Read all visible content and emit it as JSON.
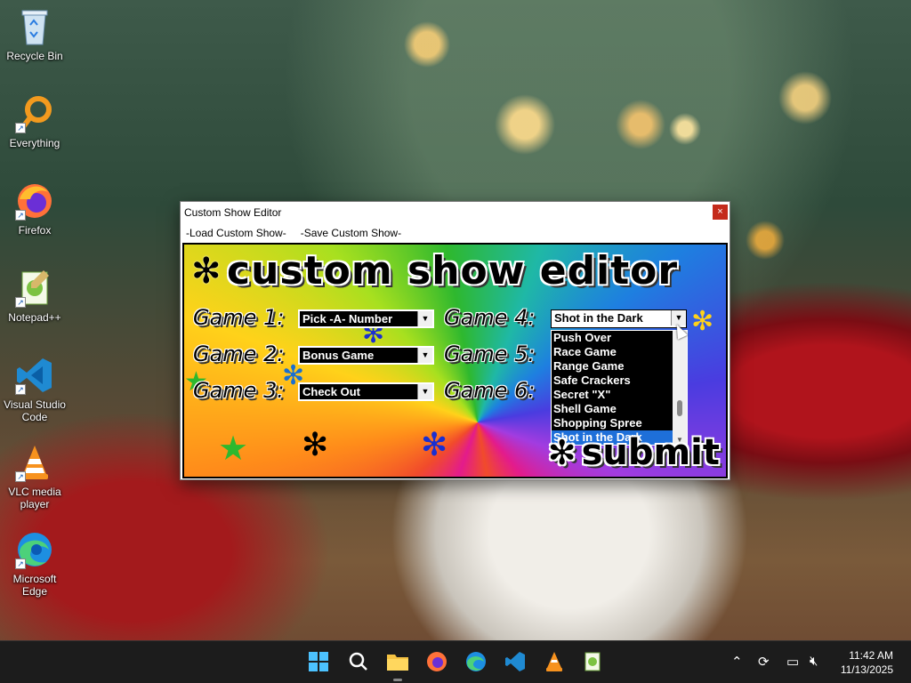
{
  "desktop": {
    "icons": [
      {
        "label": "Recycle Bin",
        "icon": "recycle-bin-icon"
      },
      {
        "label": "Everything",
        "icon": "search-icon"
      },
      {
        "label": "Firefox",
        "icon": "firefox-icon"
      },
      {
        "label": "Notepad++",
        "icon": "notepad-plus-plus-icon"
      },
      {
        "label": "Visual Studio Code",
        "icon": "vscode-icon"
      },
      {
        "label": "VLC media player",
        "icon": "vlc-icon"
      },
      {
        "label": "Microsoft Edge",
        "icon": "edge-icon"
      }
    ]
  },
  "window": {
    "title": "Custom Show Editor",
    "close_glyph": "×",
    "menu": [
      "-Load Custom Show-",
      "-Save Custom Show-"
    ]
  },
  "editor": {
    "heading": "custom show editor",
    "games": [
      {
        "label": "Game 1:",
        "value": "Pick -A- Number"
      },
      {
        "label": "Game 2:",
        "value": "Bonus Game"
      },
      {
        "label": "Game 3:",
        "value": "Check Out"
      },
      {
        "label": "Game 4:",
        "value": "Shot in the Dark"
      },
      {
        "label": "Game 5:",
        "value": ""
      },
      {
        "label": "Game 6:",
        "value": ""
      }
    ],
    "dropdown_options": [
      "Push Over",
      "Race Game",
      "Range Game",
      "Safe Crackers",
      "Secret \"X\"",
      "Shell Game",
      "Shopping Spree",
      "Shot in the Dark"
    ],
    "dropdown_selected": "Shot in the Dark",
    "submit_label": "submit"
  },
  "taskbar": {
    "apps": [
      "start-icon",
      "search-icon",
      "file-explorer-icon",
      "firefox-icon",
      "edge-icon",
      "vscode-icon",
      "vlc-icon",
      "notepad-plus-plus-icon"
    ],
    "time": "11:42 AM",
    "date": "11/13/2025"
  }
}
